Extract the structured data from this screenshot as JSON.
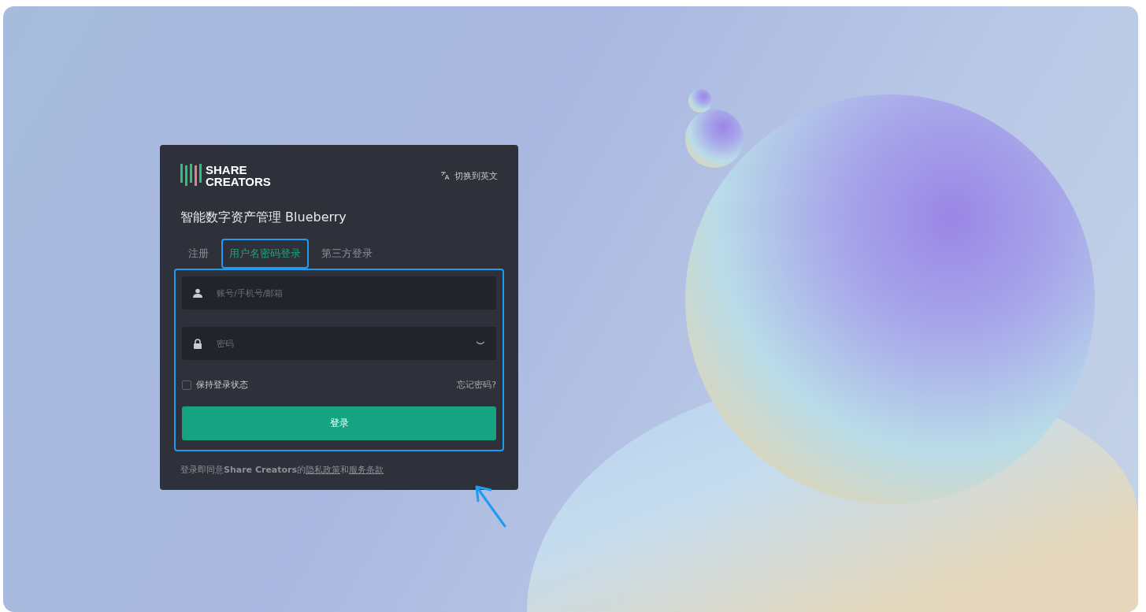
{
  "header": {
    "logo_top": "SHARE",
    "logo_bottom": "CREATORS",
    "language_switch": "切换到英文"
  },
  "title": "智能数字资产管理 Blueberry",
  "tabs": [
    {
      "label": "注册",
      "selected": false,
      "highlighted": false
    },
    {
      "label": "用户名密码登录",
      "selected": true,
      "highlighted": true
    },
    {
      "label": "第三方登录",
      "selected": false,
      "highlighted": false
    }
  ],
  "form": {
    "highlighted": true,
    "username": {
      "placeholder": "账号/手机号/邮箱"
    },
    "password": {
      "placeholder": "密码"
    },
    "remember": {
      "label": "保持登录状态",
      "checked": false
    },
    "forgot_link": "忘记密码?",
    "submit": "登录"
  },
  "footer": {
    "prefix": "登录即同意**Share Creators**的",
    "privacy_link": "隐私政策",
    "joiner": "和",
    "terms_link": "服务条款"
  }
}
